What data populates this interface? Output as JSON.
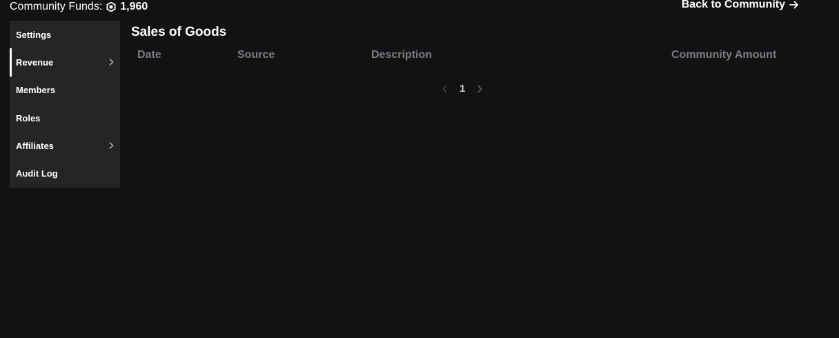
{
  "header": {
    "funds_label": "Community Funds:",
    "funds_amount": "1,960",
    "funds_icon": "robux-icon",
    "back_label": "Back to Community",
    "back_icon": "arrow-right-icon"
  },
  "sidebar": {
    "items": [
      {
        "label": "Settings",
        "active": false,
        "has_chevron": false
      },
      {
        "label": "Revenue",
        "active": true,
        "has_chevron": true
      },
      {
        "label": "Members",
        "active": false,
        "has_chevron": false
      },
      {
        "label": "Roles",
        "active": false,
        "has_chevron": false
      },
      {
        "label": "Affiliates",
        "active": false,
        "has_chevron": true
      },
      {
        "label": "Audit Log",
        "active": false,
        "has_chevron": false
      }
    ]
  },
  "main": {
    "title": "Sales of Goods",
    "columns": [
      "Date",
      "Source",
      "Description",
      "Community Amount"
    ],
    "rows": [],
    "pagination": {
      "current_page": "1"
    }
  },
  "colors": {
    "background": "#121215",
    "sidebar": "#232527",
    "header_text": "#7b7d80",
    "text": "#ffffff"
  }
}
